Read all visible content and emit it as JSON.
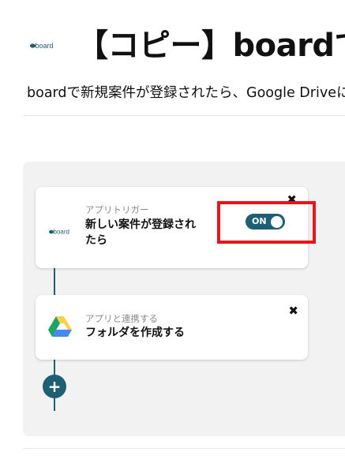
{
  "header": {
    "logo_icon": "board-logo-icon",
    "title": "【コピー】boardで",
    "subtitle": "boardで新規案件が登録されたら、Google Driveに"
  },
  "flow": {
    "trigger": {
      "icon": "board-logo-icon",
      "kind": "アプリトリガー",
      "name": "新しい案件が登録されたら",
      "close_label": "✖",
      "toggle": {
        "label": "ON",
        "state": "on"
      }
    },
    "action": {
      "icon": "google-drive-icon",
      "kind": "アプリと連携する",
      "name": "フォルダを作成する",
      "close_label": "✖"
    },
    "add_step_label": "+"
  },
  "colors": {
    "accent": "#1e5f73",
    "highlight": "#e8151b",
    "panel_bg": "#f2f2f2"
  }
}
